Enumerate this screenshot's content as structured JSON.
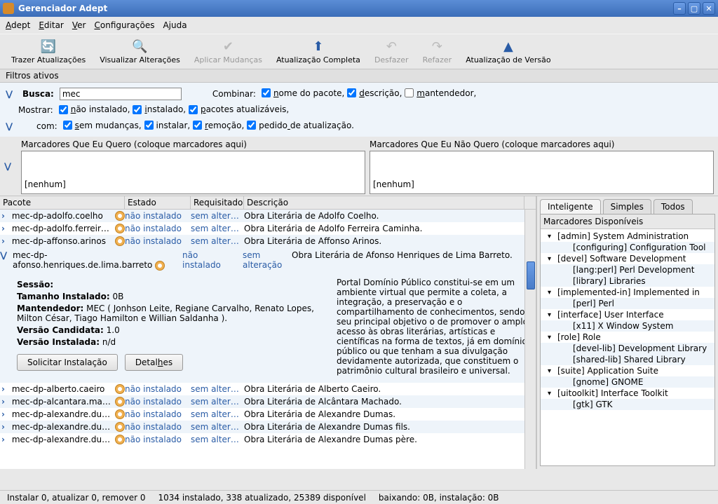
{
  "window": {
    "title": "Gerenciador Adept"
  },
  "menubar": [
    {
      "label": "Adept",
      "u": 0
    },
    {
      "label": "Editar",
      "u": 0
    },
    {
      "label": "Ver",
      "u": 0
    },
    {
      "label": "Configurações",
      "u": 0
    },
    {
      "label": "Ajuda",
      "u": -1
    }
  ],
  "toolbar": [
    {
      "label": "Trazer Atualizações",
      "icon": "🔄",
      "enabled": true,
      "color": "#2c9a2c"
    },
    {
      "label": "Visualizar Alterações",
      "icon": "🔍",
      "enabled": true,
      "color": "#333"
    },
    {
      "label": "Aplicar Mudanças",
      "icon": "✔",
      "enabled": false,
      "color": "#bbb"
    },
    {
      "label": "Atualização Completa",
      "icon": "⬆",
      "enabled": true,
      "color": "#2a5ca6"
    },
    {
      "label": "Desfazer",
      "icon": "↶",
      "enabled": false,
      "color": "#bbb"
    },
    {
      "label": "Refazer",
      "icon": "↷",
      "enabled": false,
      "color": "#bbb"
    },
    {
      "label": "Atualização de Versão",
      "icon": "▲",
      "enabled": true,
      "color": "#2a5ca6"
    }
  ],
  "filters": {
    "header": "Filtros ativos",
    "busca_label": "Busca:",
    "busca_value": "mec",
    "combinar_label": "Combinar:",
    "combinar": [
      {
        "label": "nome do pacote,",
        "checked": true,
        "u": 0
      },
      {
        "label": "descrição,",
        "checked": true,
        "u": 0
      },
      {
        "label": "mantendedor,",
        "checked": false,
        "u": 0
      }
    ],
    "mostrar_label": "Mostrar:",
    "mostrar": [
      {
        "label": "não instalado,",
        "checked": true,
        "u": 0
      },
      {
        "label": "instalado,",
        "checked": true,
        "u": 0
      },
      {
        "label": "pacotes atualizáveis,",
        "checked": true,
        "u": 0
      }
    ],
    "com_label": "com:",
    "com": [
      {
        "label": "sem mudanças,",
        "checked": true,
        "u": 0
      },
      {
        "label": "instalar,",
        "checked": true,
        "u": -1
      },
      {
        "label": "remoção,",
        "checked": true,
        "u": 0
      },
      {
        "label": "pedido de atualização.",
        "checked": true,
        "u": 6
      }
    ],
    "tags_want": "Marcadores Que Eu Quero (coloque marcadores aqui)",
    "tags_notwant": "Marcadores Que Eu Não Quero (coloque marcadores aqui)",
    "none": "[nenhum]"
  },
  "packages": {
    "columns": [
      "Pacote",
      "Estado",
      "Requisitado",
      "Descrição"
    ],
    "rows": [
      {
        "name": "mec-dp-adolfo.coelho",
        "state": "não instalado",
        "req": "sem alter…",
        "desc": "Obra Literária de Adolfo Coelho."
      },
      {
        "name": "mec-dp-adolfo.ferreira.c…",
        "state": "não instalado",
        "req": "sem alter…",
        "desc": "Obra Literária de Adolfo Ferreira Caminha."
      },
      {
        "name": "mec-dp-affonso.arinos",
        "state": "não instalado",
        "req": "sem alter…",
        "desc": "Obra Literária de Affonso Arinos."
      }
    ],
    "expanded": {
      "name": "mec-dp-afonso.henriques.de.lima.barreto",
      "state": "não instalado",
      "req": "sem alteração",
      "desc": "Obra Literária de Afonso Henriques de Lima Barreto.",
      "long": "Portal Domínio Público constitui-se em um ambiente virtual que permite a coleta, a integração, a preservação e o compartilhamento de conhecimentos, sendo seu principal objetivo o de promover o amplo acesso às obras literárias, artísticas e científicas na forma de textos, já em domínio público ou que tenham a sua divulgação devidamente autorizada, que constituem o patrimônio cultural brasileiro e universal.",
      "session_label": "Sessão:",
      "size_label": "Tamanho Instalado:",
      "size_value": "0B",
      "maint_label": "Mantendedor:",
      "maint_value": "MEC ( Jonhson Leite, Regiane Carvalho, Renato Lopes, Milton César, Tiago Hamilton e Willian Saldanha ).",
      "cand_label": "Versão Candidata:",
      "cand_value": "1.0",
      "inst_label": "Versão Instalada:",
      "inst_value": "n/d",
      "btn_request": "Solicitar Instalação",
      "btn_details": "Detalhes"
    },
    "rows_after": [
      {
        "name": "mec-dp-alberto.caeiro",
        "state": "não instalado",
        "req": "sem alter…",
        "desc": "Obra Literária de Alberto Caeiro."
      },
      {
        "name": "mec-dp-alcantara.mach…",
        "state": "não instalado",
        "req": "sem alter…",
        "desc": "Obra Literária de Alcântara Machado."
      },
      {
        "name": "mec-dp-alexandre.dumas",
        "state": "não instalado",
        "req": "sem alter…",
        "desc": "Obra Literária de Alexandre Dumas."
      },
      {
        "name": "mec-dp-alexandre.dum…",
        "state": "não instalado",
        "req": "sem alter…",
        "desc": "Obra Literária de Alexandre Dumas fils."
      },
      {
        "name": "mec-dp-alexandre.dum…",
        "state": "não instalado",
        "req": "sem alter…",
        "desc": "Obra Literária de Alexandre Dumas père."
      }
    ]
  },
  "right": {
    "tabs": [
      "Inteligente",
      "Simples",
      "Todos"
    ],
    "active": 0,
    "title": "Marcadores Disponíveis",
    "tree": [
      {
        "l": 1,
        "label": "[admin] System Administration"
      },
      {
        "l": 2,
        "label": "[configuring] Configuration Tool"
      },
      {
        "l": 1,
        "label": "[devel] Software Development"
      },
      {
        "l": 2,
        "label": "[lang:perl] Perl Development"
      },
      {
        "l": 2,
        "label": "[library] Libraries"
      },
      {
        "l": 1,
        "label": "[implemented-in] Implemented in"
      },
      {
        "l": 2,
        "label": "[perl] Perl"
      },
      {
        "l": 1,
        "label": "[interface] User Interface"
      },
      {
        "l": 2,
        "label": "[x11] X Window System"
      },
      {
        "l": 1,
        "label": "[role] Role"
      },
      {
        "l": 2,
        "label": "[devel-lib] Development Library"
      },
      {
        "l": 2,
        "label": "[shared-lib] Shared Library"
      },
      {
        "l": 1,
        "label": "[suite] Application Suite"
      },
      {
        "l": 2,
        "label": "[gnome] GNOME"
      },
      {
        "l": 1,
        "label": "[uitoolkit] Interface Toolkit"
      },
      {
        "l": 2,
        "label": "[gtk] GTK"
      }
    ]
  },
  "status": {
    "s1": "Instalar 0, atualizar 0, remover 0",
    "s2": "1034 instalado, 338 atualizado, 25389 disponível",
    "s3": "baixando: 0B, instalação: 0B"
  }
}
